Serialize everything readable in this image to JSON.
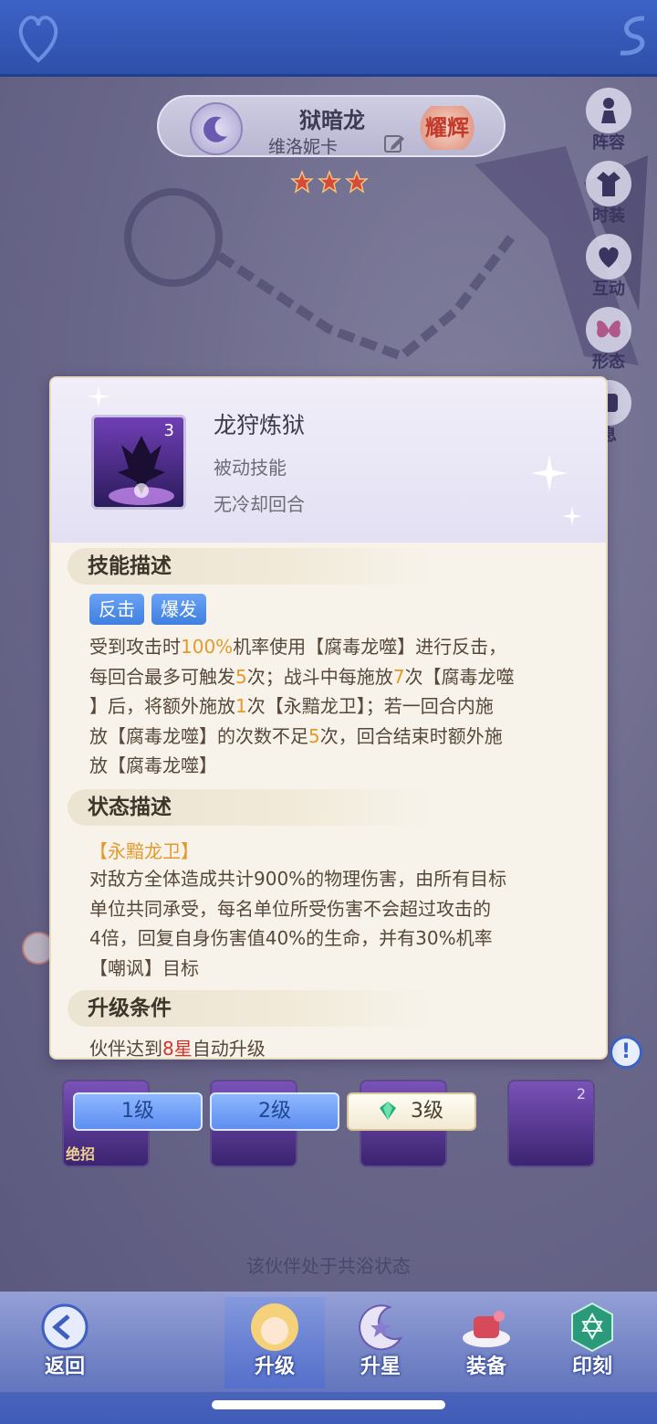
{
  "character": {
    "name": "狱暗龙",
    "subname": "维洛妮卡",
    "badge": "耀辉",
    "stars": 3
  },
  "side_menu": [
    {
      "label": "阵容",
      "icon": "pawn-icon"
    },
    {
      "label": "时装",
      "icon": "outfit-icon"
    },
    {
      "label": "互动",
      "icon": "heart-icon"
    },
    {
      "label": "形态",
      "icon": "butterfly-icon"
    },
    {
      "label": "息",
      "icon": "info-icon"
    }
  ],
  "skill_popup": {
    "name": "龙狩炼狱",
    "level_badge": "3",
    "type": "被动技能",
    "cooldown": "无冷却回合",
    "sections": {
      "skill_desc": "技能描述",
      "status_desc": "状态描述",
      "upgrade": "升级条件"
    },
    "tags": [
      "反击",
      "爆发"
    ],
    "description_lines": [
      [
        "受到攻击时",
        "100%",
        "机率使用【腐毒龙噬】进行反击，"
      ],
      [
        "每回合最多可触发",
        "5",
        "次；战斗中每施放",
        "7",
        "次【腐毒龙噬"
      ],
      [
        "】后，将额外施放",
        "1",
        "次【永黯龙卫】；若一回合内施"
      ],
      [
        "放【腐毒龙噬】的次数不足",
        "5",
        "次，回合结束时额外施"
      ],
      [
        "放【腐毒龙噬】"
      ]
    ],
    "status_name": "【永黯龙卫】",
    "status_lines": [
      "对敌方全体造成共计900%的物理伤害，由所有目标",
      "单位共同承受，每名单位所受伤害不会超过攻击的",
      "4倍，回复自身伤害值40%的生命，并有30%机率",
      "【嘲讽】目标"
    ],
    "upgrade_parts": [
      "伙伴达到",
      "8星",
      "自动升级"
    ]
  },
  "level_buttons": [
    "1级",
    "2级",
    "3级"
  ],
  "skill_cards": {
    "ultimate_tag": "绝招",
    "card_count": "2"
  },
  "cohab_text": "该伙伴处于共浴状态",
  "bottom_nav": {
    "back": "返回",
    "upgrade": "升级",
    "star_up": "升星",
    "equip": "装备",
    "imprint": "印刻"
  },
  "colors": {
    "accent_blue": "#3f7fe0",
    "highlight_orange": "#e49a2a",
    "highlight_red": "#d4322a",
    "popup_bg": "#f7f3ea"
  }
}
